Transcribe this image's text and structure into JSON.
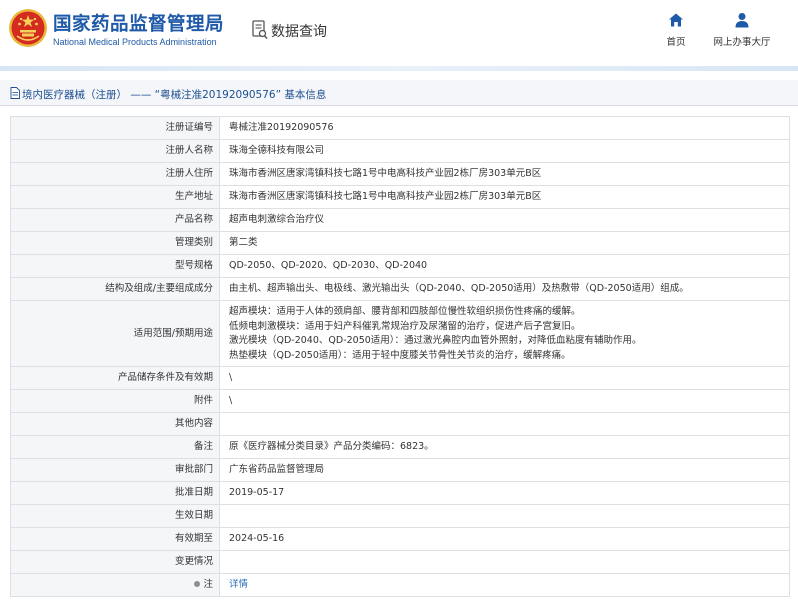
{
  "header": {
    "title": "国家药品监督管理局",
    "subtitle": "National Medical Products Administration",
    "query_label": "数据查询",
    "nav": [
      {
        "label": "首页",
        "icon": "home-icon"
      },
      {
        "label": "网上办事大厅",
        "icon": "person-icon"
      }
    ]
  },
  "colors": {
    "brand_blue": "#1f5aa8",
    "link_blue": "#2a6ebb",
    "emblem_red": "#d42a1f",
    "emblem_gold": "#e8b83a"
  },
  "breadcrumb": {
    "text": "境内医疗器械（注册） —— “粤械注准20192090576” 基本信息"
  },
  "table": {
    "rows": [
      {
        "label": "注册证编号",
        "value": "粤械注准20192090576"
      },
      {
        "label": "注册人名称",
        "value": "珠海全德科技有限公司"
      },
      {
        "label": "注册人住所",
        "value": "珠海市香洲区唐家湾镇科技七路1号中电高科技产业园2栋厂房303单元B区"
      },
      {
        "label": "生产地址",
        "value": "珠海市香洲区唐家湾镇科技七路1号中电高科技产业园2栋厂房303单元B区"
      },
      {
        "label": "产品名称",
        "value": "超声电刺激综合治疗仪"
      },
      {
        "label": "管理类别",
        "value": "第二类"
      },
      {
        "label": "型号规格",
        "value": "QD-2050、QD-2020、QD-2030、QD-2040"
      },
      {
        "label": "结构及组成/主要组成成分",
        "value": "由主机、超声输出头、电极线、激光输出头（QD-2040、QD-2050适用）及热敷带（QD-2050适用）组成。"
      },
      {
        "label": "适用范围/预期用途",
        "lines": [
          "超声模块：适用于人体的颈肩部、腰背部和四肢部位慢性软组织损伤性疼痛的缓解。",
          "低频电刺激模块：适用于妇产科催乳常规治疗及尿潴留的治疗，促进产后子宫复旧。",
          "激光模块（QD-2040、QD-2050适用）：通过激光鼻腔内血管外照射，对降低血粘度有辅助作用。",
          "热垫模块（QD-2050适用）：适用于轻中度膝关节骨性关节炎的治疗，缓解疼痛。"
        ]
      },
      {
        "label": "产品储存条件及有效期",
        "value": "\\"
      },
      {
        "label": "附件",
        "value": "\\"
      },
      {
        "label": "其他内容",
        "value": ""
      },
      {
        "label": "备注",
        "value": "原《医疗器械分类目录》产品分类编码：6823。"
      },
      {
        "label": "审批部门",
        "value": "广东省药品监督管理局"
      },
      {
        "label": "批准日期",
        "value": "2019-05-17"
      },
      {
        "label": "生效日期",
        "value": ""
      },
      {
        "label": "有效期至",
        "value": "2024-05-16"
      },
      {
        "label": "变更情况",
        "value": ""
      },
      {
        "label": "注",
        "value": "详情",
        "icon": "note-icon"
      }
    ]
  }
}
